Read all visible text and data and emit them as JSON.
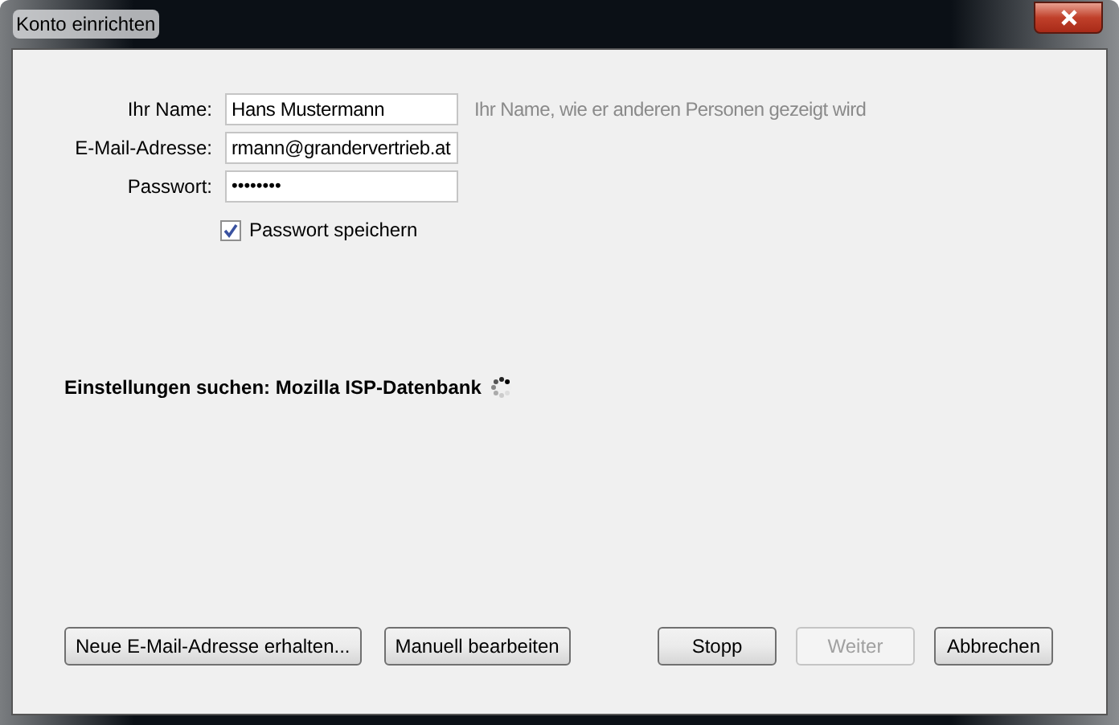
{
  "window": {
    "title": "Konto einrichten"
  },
  "fields": [
    {
      "label": "Ihr Name:",
      "value": "Hans Mustermann",
      "hint": "Ihr Name, wie er anderen Personen gezeigt wird",
      "kind": "text"
    },
    {
      "label": "E-Mail-Adresse:",
      "value": "rmann@grandervertrieb.at",
      "kind": "text"
    },
    {
      "label": "Passwort:",
      "value": "••••••••",
      "kind": "password"
    }
  ],
  "remember_password": {
    "label": "Passwort speichern",
    "checked": true
  },
  "status": {
    "text": "Einstellungen suchen: Mozilla ISP-Datenbank",
    "busy": true
  },
  "left_buttons": [
    {
      "label": "Neue E-Mail-Adresse erhalten...",
      "disabled": false
    },
    {
      "label": "Manuell bearbeiten",
      "disabled": false
    }
  ],
  "right_buttons": [
    {
      "label": "Stopp",
      "disabled": false
    },
    {
      "label": "Weiter",
      "disabled": true
    },
    {
      "label": "Abbrechen",
      "disabled": false
    }
  ]
}
